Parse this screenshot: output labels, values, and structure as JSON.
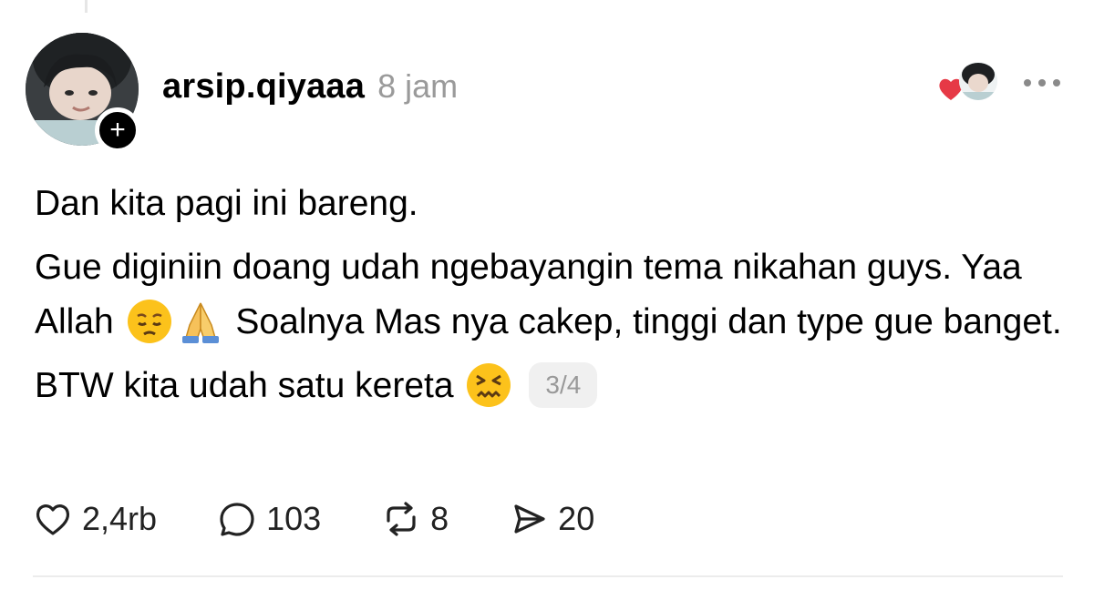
{
  "post": {
    "username": "arsip.qiyaaa",
    "time_ago": "8 jam",
    "paragraphs": {
      "p1": "Dan kita pagi ini bareng.",
      "p2a": "Gue diginiin doang udah ngebayangin tema nikahan guys. Yaa Allah",
      "p2b": "Soalnya Mas nya cakep, tinggi dan type gue banget.",
      "p3": "BTW kita udah satu kereta"
    },
    "page_indicator": "3/4",
    "emojis": [
      "pensive-face",
      "folded-hands",
      "confounded-face"
    ]
  },
  "actions": {
    "likes": "2,4rb",
    "replies": "103",
    "reposts": "8",
    "shares": "20"
  },
  "icons": [
    "plus-icon",
    "heart-icon",
    "more-icon",
    "comment-icon",
    "repost-icon",
    "send-icon"
  ],
  "colors": {
    "text": "#000000",
    "muted": "#9a9a9a",
    "heart_red": "#e63946",
    "badge_bg": "#f0f0f0",
    "emoji_yellow": "#fcc21b"
  }
}
